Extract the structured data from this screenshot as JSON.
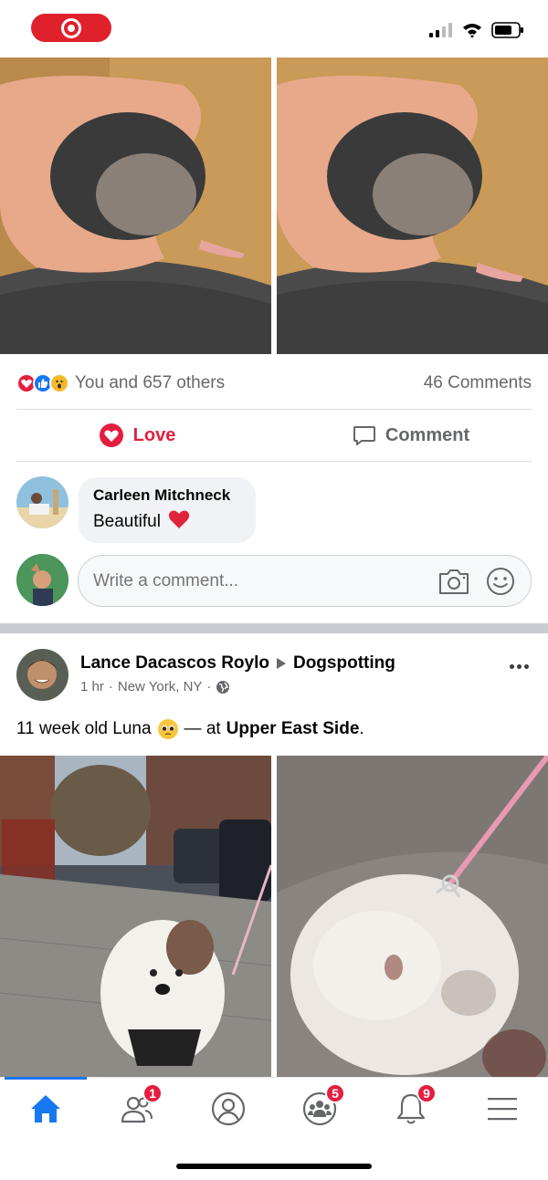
{
  "post1": {
    "reactions_text": "You and 657 others",
    "comments_count": "46 Comments",
    "love_label": "Love",
    "comment_label": "Comment",
    "comment": {
      "author": "Carleen Mitchneck",
      "text": "Beautiful"
    },
    "write_placeholder": "Write a comment..."
  },
  "post2": {
    "author": "Lance Dacascos Roylo",
    "group": "Dogspotting",
    "time": "1 hr",
    "location": "New York, NY",
    "text_before": "11 week old Luna",
    "text_mid": "— at",
    "place": "Upper East Side",
    "text_end": "."
  },
  "nav": {
    "friends_badge": "1",
    "groups_badge": "5",
    "notifications_badge": "9"
  },
  "colors": {
    "love": "#e41e3f",
    "accent": "#1877f2",
    "badge": "#e41e3f"
  }
}
